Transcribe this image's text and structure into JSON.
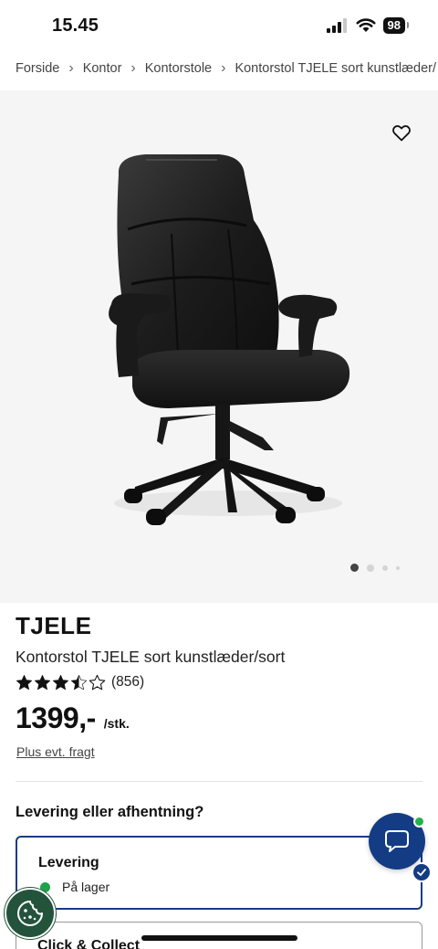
{
  "status_bar": {
    "time": "15.45",
    "battery": "98"
  },
  "breadcrumb": [
    "Forside",
    "Kontor",
    "Kontorstole",
    "Kontorstol TJELE sort kunstlæder/"
  ],
  "product": {
    "brand": "TJELE",
    "name": "Kontorstol TJELE sort kunstlæder/sort",
    "rating": 3.5,
    "rating_max": 5,
    "review_count": "(856)",
    "price": "1399,-",
    "price_unit": "/stk.",
    "freight_link": "Plus evt. fragt"
  },
  "gallery": {
    "image_count": 4,
    "active_index": 0
  },
  "delivery": {
    "heading": "Levering eller afhentning?",
    "options": [
      {
        "title": "Levering",
        "stock": "På lager",
        "selected": true
      },
      {
        "title": "Click & Collect",
        "selected": false
      }
    ]
  },
  "colors": {
    "primary": "#143c84",
    "in_stock": "#1fa34a",
    "cookie": "#24533b"
  },
  "icons": [
    "signal-icon",
    "wifi-icon",
    "battery-icon",
    "chevron-right-icon",
    "heart-icon",
    "star-icon",
    "chat-icon",
    "check-icon",
    "cookie-icon"
  ]
}
